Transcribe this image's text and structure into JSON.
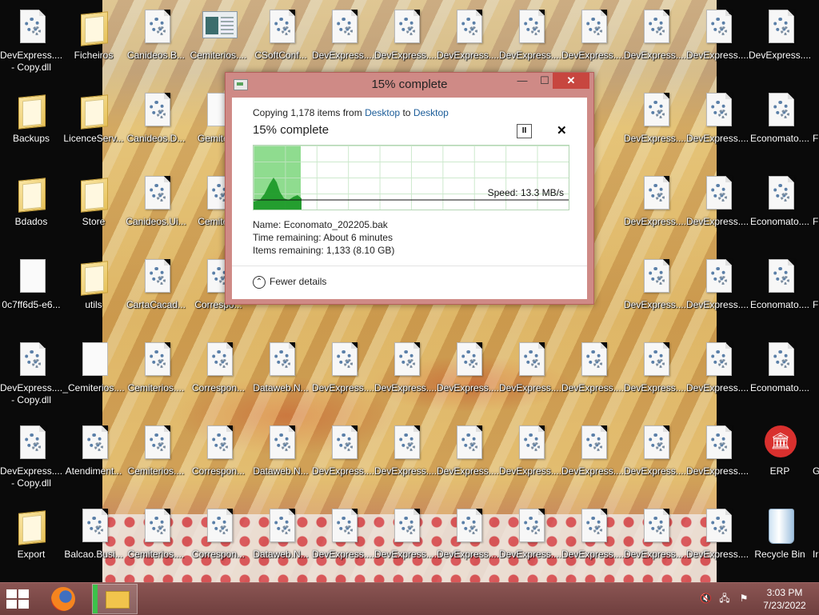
{
  "desktop": {
    "icons": [
      {
        "label": "DevExpress....",
        "label2": "- Copy.dll",
        "kind": "file",
        "col": 0,
        "row": 0
      },
      {
        "label": "Ficheiros",
        "kind": "folder",
        "col": 1,
        "row": 0
      },
      {
        "label": "Canideos.B...",
        "kind": "file",
        "col": 2,
        "row": 0
      },
      {
        "label": "Cemiterios....",
        "kind": "thumb",
        "col": 3,
        "row": 0
      },
      {
        "label": "CSoftConf...",
        "kind": "file",
        "col": 4,
        "row": 0
      },
      {
        "label": "DevExpress....",
        "kind": "file",
        "col": 5,
        "row": 0
      },
      {
        "label": "DevExpress....",
        "kind": "file",
        "col": 6,
        "row": 0
      },
      {
        "label": "DevExpress....",
        "kind": "file",
        "col": 7,
        "row": 0
      },
      {
        "label": "DevExpress....",
        "kind": "file",
        "col": 8,
        "row": 0
      },
      {
        "label": "DevExpress....",
        "kind": "file",
        "col": 9,
        "row": 0
      },
      {
        "label": "DevExpress....",
        "kind": "file",
        "col": 10,
        "row": 0
      },
      {
        "label": "DevExpress....",
        "kind": "file",
        "col": 11,
        "row": 0
      },
      {
        "label": "DevExpress....",
        "kind": "file",
        "col": 12,
        "row": 0
      },
      {
        "label": "Backups",
        "kind": "folder",
        "col": 0,
        "row": 1
      },
      {
        "label": "LicenceServ...",
        "kind": "folder",
        "col": 1,
        "row": 1
      },
      {
        "label": "Canideos.D...",
        "kind": "file",
        "col": 2,
        "row": 1
      },
      {
        "label": "Gemiter...",
        "kind": "page",
        "col": 3,
        "row": 1
      },
      {
        "label": "DevExpress....",
        "kind": "file",
        "col": 10,
        "row": 1
      },
      {
        "label": "DevExpress....",
        "kind": "file",
        "col": 11,
        "row": 1
      },
      {
        "label": "Economato....",
        "kind": "file",
        "col": 12,
        "row": 1
      },
      {
        "label": "Bdados",
        "kind": "folder",
        "col": 0,
        "row": 2
      },
      {
        "label": "Store",
        "kind": "folder",
        "col": 1,
        "row": 2
      },
      {
        "label": "Canideos.Ui...",
        "kind": "file",
        "col": 2,
        "row": 2
      },
      {
        "label": "Cemiter...",
        "kind": "file",
        "col": 3,
        "row": 2
      },
      {
        "label": "DevExpress....",
        "kind": "file",
        "col": 10,
        "row": 2
      },
      {
        "label": "DevExpress....",
        "kind": "file",
        "col": 11,
        "row": 2
      },
      {
        "label": "Economato....",
        "kind": "file",
        "col": 12,
        "row": 2
      },
      {
        "label": "0c7ff6d5-e6...",
        "kind": "page",
        "col": 0,
        "row": 3
      },
      {
        "label": "utils",
        "kind": "folder",
        "col": 1,
        "row": 3
      },
      {
        "label": "CartaCacad...",
        "kind": "file",
        "col": 2,
        "row": 3
      },
      {
        "label": "Correspo...",
        "kind": "file",
        "col": 3,
        "row": 3
      },
      {
        "label": "DevExpress....",
        "kind": "file",
        "col": 10,
        "row": 3
      },
      {
        "label": "DevExpress....",
        "kind": "file",
        "col": 11,
        "row": 3
      },
      {
        "label": "Economato....",
        "kind": "file",
        "col": 12,
        "row": 3
      },
      {
        "label": "DevExpress....",
        "label2": "- Copy.dll",
        "kind": "file",
        "col": 0,
        "row": 4
      },
      {
        "label": "_Cemiterios....",
        "kind": "page",
        "col": 1,
        "row": 4
      },
      {
        "label": "Cemiterios....",
        "kind": "file",
        "col": 2,
        "row": 4
      },
      {
        "label": "Correspon...",
        "kind": "file",
        "col": 3,
        "row": 4
      },
      {
        "label": "Dataweb.N...",
        "kind": "file",
        "col": 4,
        "row": 4
      },
      {
        "label": "DevExpress....",
        "kind": "file",
        "col": 5,
        "row": 4
      },
      {
        "label": "DevExpress....",
        "kind": "file",
        "col": 6,
        "row": 4
      },
      {
        "label": "DevExpress....",
        "kind": "file",
        "col": 7,
        "row": 4
      },
      {
        "label": "DevExpress....",
        "kind": "file",
        "col": 8,
        "row": 4
      },
      {
        "label": "DevExpress....",
        "kind": "file",
        "col": 9,
        "row": 4
      },
      {
        "label": "DevExpress....",
        "kind": "file",
        "col": 10,
        "row": 4
      },
      {
        "label": "DevExpress....",
        "kind": "file",
        "col": 11,
        "row": 4
      },
      {
        "label": "Economato....",
        "kind": "file",
        "col": 12,
        "row": 4
      },
      {
        "label": "DevExpress....",
        "label2": "- Copy.dll",
        "kind": "file",
        "col": 0,
        "row": 5
      },
      {
        "label": "Atendiment...",
        "kind": "file",
        "col": 1,
        "row": 5
      },
      {
        "label": "Cemiterios....",
        "kind": "file",
        "col": 2,
        "row": 5
      },
      {
        "label": "Correspon...",
        "kind": "file",
        "col": 3,
        "row": 5
      },
      {
        "label": "Dataweb.N...",
        "kind": "file",
        "col": 4,
        "row": 5
      },
      {
        "label": "DevExpress....",
        "kind": "file",
        "col": 5,
        "row": 5
      },
      {
        "label": "DevExpress....",
        "kind": "file",
        "col": 6,
        "row": 5
      },
      {
        "label": "DevExpress....",
        "kind": "file",
        "col": 7,
        "row": 5
      },
      {
        "label": "DevExpress....",
        "kind": "file",
        "col": 8,
        "row": 5
      },
      {
        "label": "DevExpress....",
        "kind": "file",
        "col": 9,
        "row": 5
      },
      {
        "label": "DevExpress....",
        "kind": "file",
        "col": 10,
        "row": 5
      },
      {
        "label": "DevExpress....",
        "kind": "file",
        "col": 11,
        "row": 5
      },
      {
        "label": "ERP",
        "kind": "erp",
        "col": 12,
        "row": 5
      },
      {
        "label": "Export",
        "kind": "folder",
        "col": 0,
        "row": 6
      },
      {
        "label": "Balcao.Busi...",
        "kind": "file",
        "col": 1,
        "row": 6
      },
      {
        "label": "Cemiterios....",
        "kind": "file",
        "col": 2,
        "row": 6
      },
      {
        "label": "Correspon...",
        "kind": "file",
        "col": 3,
        "row": 6
      },
      {
        "label": "Dataweb.N...",
        "kind": "file",
        "col": 4,
        "row": 6
      },
      {
        "label": "DevExpress....",
        "kind": "file",
        "col": 5,
        "row": 6
      },
      {
        "label": "DevExpress....",
        "kind": "file",
        "col": 6,
        "row": 6
      },
      {
        "label": "DevExpress....",
        "kind": "file",
        "col": 7,
        "row": 6
      },
      {
        "label": "DevExpress....",
        "kind": "file",
        "col": 8,
        "row": 6
      },
      {
        "label": "DevExpress....",
        "kind": "file",
        "col": 9,
        "row": 6
      },
      {
        "label": "DevExpress....",
        "kind": "file",
        "col": 10,
        "row": 6
      },
      {
        "label": "DevExpress....",
        "kind": "file",
        "col": 11,
        "row": 6
      },
      {
        "label": "Recycle Bin",
        "kind": "bin",
        "col": 12,
        "row": 6
      }
    ],
    "partial_right": [
      "F",
      "F",
      "F",
      "G",
      "Ir"
    ]
  },
  "dialog": {
    "title": "15% complete",
    "copy_prefix": "Copying 1,178 items from",
    "source": "Desktop",
    "to_word": "to",
    "destination": "Desktop",
    "percent_text": "15% complete",
    "progress_fraction": 0.15,
    "speed": "Speed: 13.3 MB/s",
    "name_label": "Name:",
    "name_value": "Economato_202205.bak",
    "time_label": "Time remaining:",
    "time_value": "About 6 minutes",
    "items_label": "Items remaining:",
    "items_value": "1,133 (8.10 GB)",
    "fewer_details": "Fewer details",
    "minimize_glyph": "—",
    "maximize_glyph": "☐",
    "close_glyph": "✕",
    "pause_glyph": "II",
    "cancel_glyph": "✕",
    "toggle_glyph": "⌃"
  },
  "taskbar": {
    "time": "3:03 PM",
    "date": "7/23/2022"
  },
  "colors": {
    "accent_link": "#1c5d99",
    "progress_green": "#8fdc8f",
    "graph_line": "#1f8a1f",
    "taskbar": "#7a4746",
    "dialog_frame": "#cf8a86"
  }
}
